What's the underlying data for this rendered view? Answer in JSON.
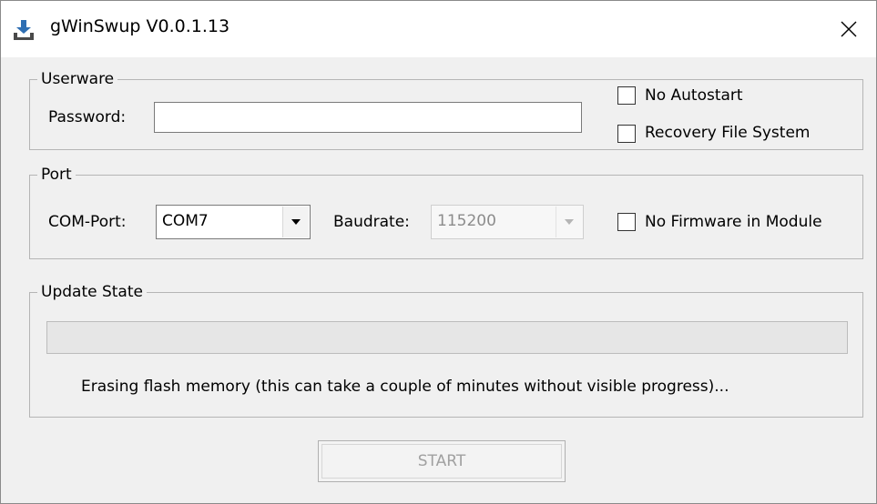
{
  "window": {
    "title": "gWinSwup V0.0.1.13",
    "icon": "app-download-icon",
    "close_icon": "close-icon"
  },
  "userware": {
    "group_label": "Userware",
    "password_label": "Password:",
    "password_value": "",
    "no_autostart_label": "No Autostart",
    "no_autostart_checked": false,
    "recovery_fs_label": "Recovery File System",
    "recovery_fs_checked": false
  },
  "port": {
    "group_label": "Port",
    "com_port_label": "COM-Port:",
    "com_port_value": "COM7",
    "baudrate_label": "Baudrate:",
    "baudrate_value": "115200",
    "baudrate_enabled": false,
    "no_firmware_label": "No Firmware in Module",
    "no_firmware_checked": false
  },
  "update_state": {
    "group_label": "Update State",
    "progress_fraction": 0,
    "status_text": "Erasing flash memory (this can take a couple of minutes without visible progress)..."
  },
  "actions": {
    "start_label": "START",
    "start_enabled": false
  },
  "colors": {
    "window_bg": "#f0f0f0",
    "titlebar_bg": "#ffffff",
    "group_border": "#b5b5b5",
    "disabled_text": "#a0a0a0",
    "progress_fill": "#06b025"
  }
}
